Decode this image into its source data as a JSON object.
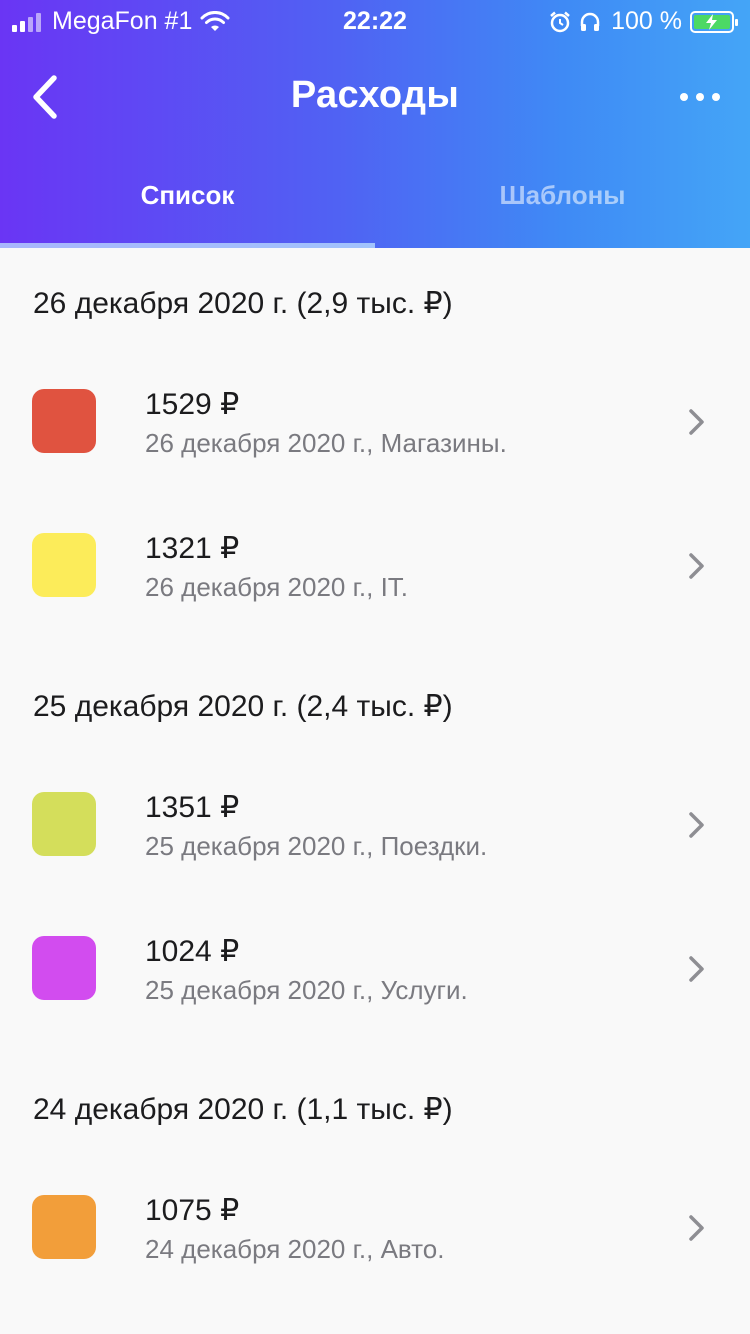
{
  "status_bar": {
    "carrier": "MegaFon #1",
    "time": "22:22",
    "battery": "100 %"
  },
  "header": {
    "title": "Расходы"
  },
  "tabs": [
    {
      "label": "Список",
      "active": true
    },
    {
      "label": "Шаблоны",
      "active": false
    }
  ],
  "groups": [
    {
      "header": "26 декабря 2020 г. (2,9 тыс. ₽)",
      "items": [
        {
          "amount": "1529 ₽",
          "subtitle": "26 декабря 2020 г., Магазины.",
          "color": "#e05340"
        },
        {
          "amount": "1321 ₽",
          "subtitle": "26 декабря 2020 г., IT.",
          "color": "#fcec5a"
        }
      ]
    },
    {
      "header": "25 декабря 2020 г. (2,4 тыс. ₽)",
      "items": [
        {
          "amount": "1351 ₽",
          "subtitle": "25 декабря 2020 г., Поездки.",
          "color": "#d4de5b"
        },
        {
          "amount": "1024 ₽",
          "subtitle": "25 декабря 2020 г., Услуги.",
          "color": "#d24cef"
        }
      ]
    },
    {
      "header": "24 декабря 2020 г. (1,1 тыс. ₽)",
      "items": [
        {
          "amount": "1075 ₽",
          "subtitle": "24 декабря 2020 г., Авто.",
          "color": "#f29e3a"
        }
      ]
    }
  ],
  "icons": {
    "back": "chevron-left-icon",
    "more": "more-horizontal-icon",
    "row": "chevron-right-icon"
  }
}
